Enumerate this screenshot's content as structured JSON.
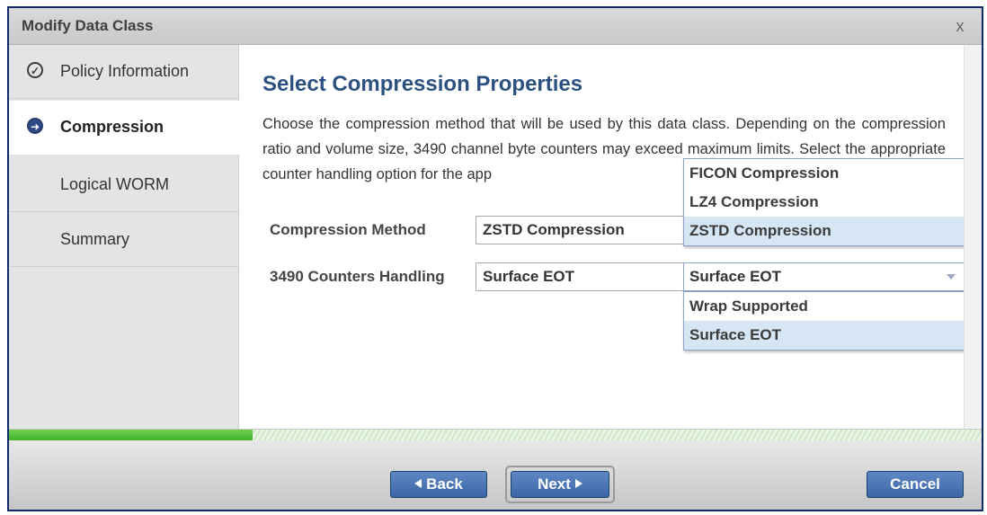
{
  "dialog": {
    "title": "Modify Data Class",
    "close_label": "x"
  },
  "sidebar": {
    "items": [
      {
        "label": "Policy Information",
        "icon": "check-circle-icon",
        "state": "completed"
      },
      {
        "label": "Compression",
        "icon": "arrow-right-circle-icon",
        "state": "active"
      },
      {
        "label": "Logical WORM",
        "icon": "",
        "state": "pending"
      },
      {
        "label": "Summary",
        "icon": "",
        "state": "pending"
      }
    ]
  },
  "main": {
    "heading": "Select Compression Properties",
    "description": "Choose the compression method that will be used by this data class. Depending on the compression ratio and volume size, 3490 channel byte counters may exceed maximum limits. Select the appropriate counter handling option for the app",
    "compression_method": {
      "label": "Compression Method",
      "value": "ZSTD Compression",
      "options": [
        "FICON Compression",
        "LZ4 Compression",
        "ZSTD Compression"
      ],
      "selected": "ZSTD Compression"
    },
    "counters_handling": {
      "label": "3490 Counters Handling",
      "value": "Surface EOT",
      "select_value": "Surface EOT",
      "options": [
        "Wrap Supported",
        "Surface EOT"
      ],
      "selected": "Surface EOT"
    }
  },
  "progress": {
    "fraction": 0.25,
    "fill_color": "#4dbb35"
  },
  "footer": {
    "back_label": "Back",
    "next_label": "Next",
    "cancel_label": "Cancel"
  },
  "colors": {
    "accent": "#2c5180",
    "button": "#4a72b3",
    "frame": "#0f2a6a"
  }
}
